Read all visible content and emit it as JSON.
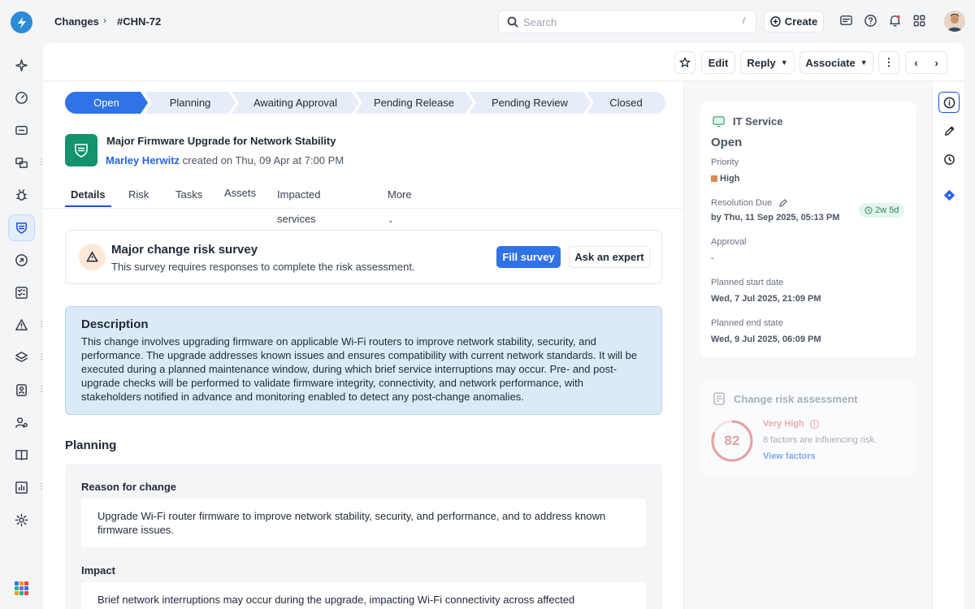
{
  "breadcrumb": {
    "section": "Changes",
    "id": "#CHN-72"
  },
  "search": {
    "placeholder": "Search",
    "shortcut": "/"
  },
  "create_label": "Create",
  "actions": {
    "edit": "Edit",
    "reply": "Reply",
    "associate": "Associate"
  },
  "stages": [
    {
      "label": "Open"
    },
    {
      "label": "Planning"
    },
    {
      "label": "Awaiting Approval"
    },
    {
      "label": "Pending Release"
    },
    {
      "label": "Pending Review"
    },
    {
      "label": "Closed"
    }
  ],
  "change": {
    "title": "Major Firmware Upgrade for Network Stability",
    "author": "Marley Herwitz",
    "created_text": "created on Thu, 09 Apr at 7:00 PM"
  },
  "tabs": [
    {
      "label": "Details"
    },
    {
      "label": "Risk"
    },
    {
      "label": "Tasks"
    },
    {
      "label": "Assets"
    },
    {
      "label": "Impacted services"
    },
    {
      "label": "More"
    }
  ],
  "survey": {
    "title": "Major change risk survey",
    "subtitle": "This survey requires responses to complete the risk assessment.",
    "fill_label": "Fill survey",
    "expert_label": "Ask an expert"
  },
  "description": {
    "heading": "Description",
    "text": "This change involves upgrading firmware on applicable Wi-Fi routers to improve network stability, security, and performance. The upgrade addresses known issues and ensures compatibility with current network standards. It will be executed during a planned maintenance window, during which brief service interruptions may occur. Pre- and post-upgrade checks will be performed to validate firmware integrity, connectivity, and network performance, with stakeholders notified in advance and monitoring enabled to detect any post-change anomalies."
  },
  "planning": {
    "heading": "Planning",
    "reason_label": "Reason for change",
    "reason_text": "Upgrade Wi-Fi router firmware to improve network stability, security, and performance, and to address known firmware issues.",
    "impact_label": "Impact",
    "impact_text": "Brief network interruptions may occur during the upgrade, impacting Wi-Fi connectivity across affected"
  },
  "properties": {
    "type": "IT Service",
    "status": "Open",
    "priority_label": "Priority",
    "priority": "High",
    "priority_color": "#e08a4f",
    "due_label": "Resolution Due",
    "due_value": "by Thu, 11 Sep 2025, 05:13 PM",
    "due_badge": "2w 5d",
    "approval_label": "Approval",
    "approval_value": "-",
    "start_label": "Planned start date",
    "start_value": "Wed, 7 Jul 2025, 21:09 PM",
    "end_label": "Planned end state",
    "end_value": "Wed, 9 Jul 2025, 06:09 PM"
  },
  "risk": {
    "heading": "Change risk assessment",
    "score": "82",
    "score_fraction": 0.82,
    "level": "Very High",
    "factors": "8 factors are influencing risk.",
    "link": "View factors"
  },
  "colors": {
    "accent": "#2f73e6",
    "change_icon": "#12936b",
    "description_bg": "#dbeaf8"
  }
}
